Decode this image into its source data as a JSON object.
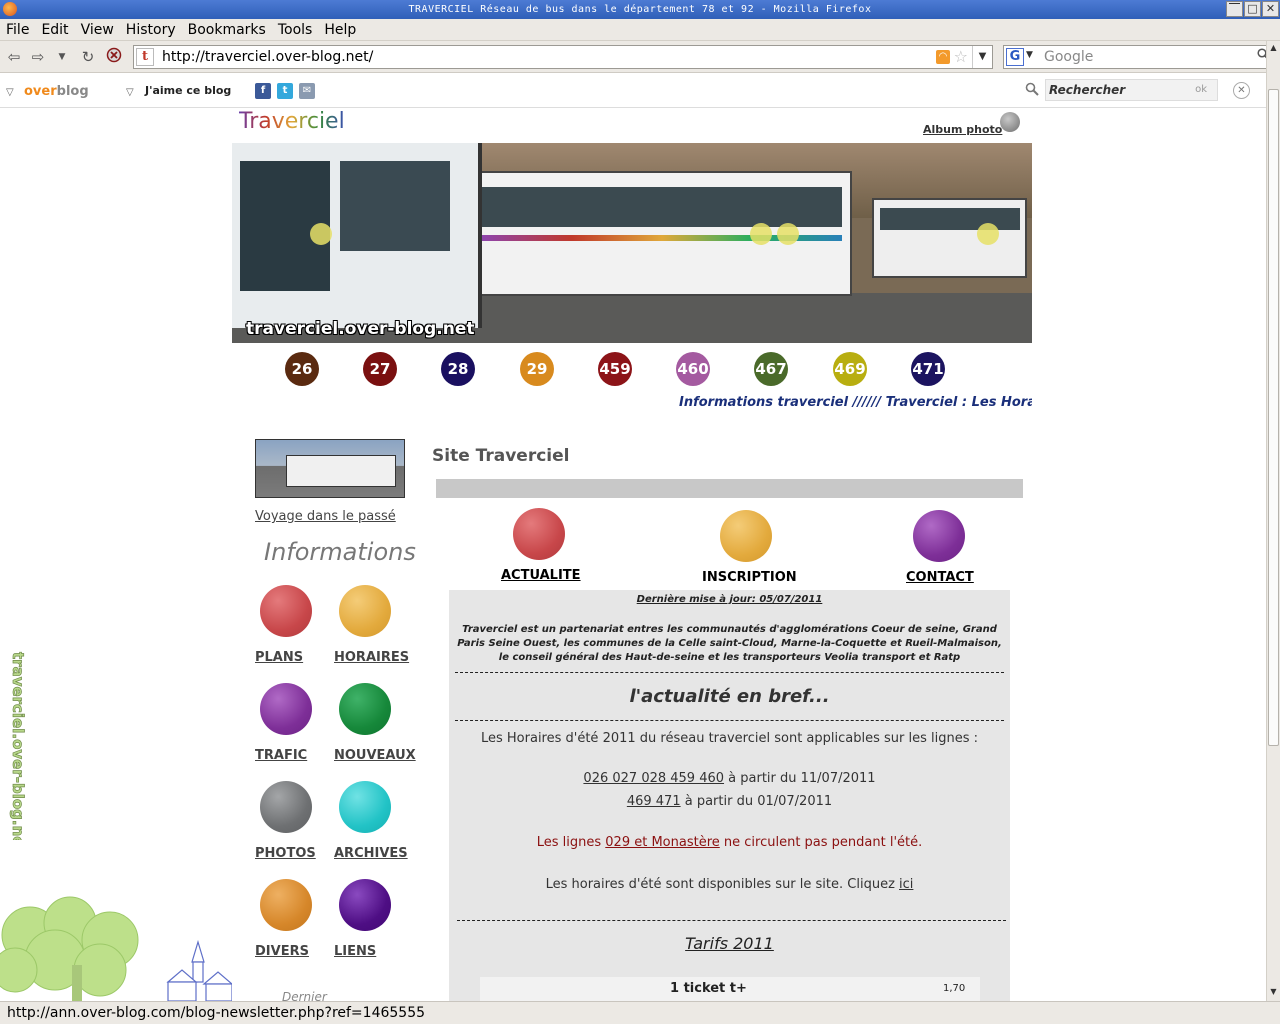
{
  "window": {
    "title": "TRAVERCIEL Réseau de bus dans le département 78 et 92 - Mozilla Firefox",
    "controls": [
      "⎺",
      "□",
      "✕"
    ]
  },
  "menu": [
    "File",
    "Edit",
    "View",
    "History",
    "Bookmarks",
    "Tools",
    "Help"
  ],
  "nav": {
    "url": "http://traverciel.over-blog.net/",
    "favicon_letter": "t",
    "search_engine_letter": "G",
    "search_placeholder": "Google"
  },
  "overblog_toolbar": {
    "logo_over": "over",
    "logo_blog": "blog",
    "like_label": "J'aime ce blog",
    "social": [
      "f",
      "t",
      "✉"
    ],
    "search_label": "Rechercher",
    "search_ok": "ok"
  },
  "status_bar": "http://ann.over-blog.com/blog-newsletter.php?ref=1465555",
  "page": {
    "blog_title": "Traverciel",
    "album_link": "Album photo",
    "banner_watermark": "traverciel.over-blog.net",
    "lines": [
      {
        "num": "26",
        "color": "#5a2a10"
      },
      {
        "num": "27",
        "color": "#7a1010"
      },
      {
        "num": "28",
        "color": "#1a1060"
      },
      {
        "num": "29",
        "color": "#d88a1e"
      },
      {
        "num": "459",
        "color": "#8c1418"
      },
      {
        "num": "460",
        "color": "#a45aa0"
      },
      {
        "num": "467",
        "color": "#4a6a2a"
      },
      {
        "num": "469",
        "color": "#b8ae10"
      },
      {
        "num": "471",
        "color": "#1c1460"
      }
    ],
    "marquee": "Informations traverciel //////  Traverciel : Les Horair",
    "sidebar": {
      "voyage_link": "Voyage dans le passé",
      "info_title": "Informations",
      "items": [
        {
          "label": "PLANS",
          "color": "#c8474a"
        },
        {
          "label": "HORAIRES",
          "color": "#e3aa3d"
        },
        {
          "label": "TRAFIC",
          "color": "#7e2f98"
        },
        {
          "label": "NOUVEAUX",
          "color": "#16883a"
        },
        {
          "label": "PHOTOS",
          "color": "#6e7072"
        },
        {
          "label": "ARCHIVES",
          "color": "#22c3c6"
        },
        {
          "label": "DIVERS",
          "color": "#d6872a"
        },
        {
          "label": "LIENS",
          "color": "#4e0e84"
        }
      ],
      "bottom_label": "Dernier"
    },
    "main": {
      "site_title": "Site Traverciel",
      "top_links": [
        {
          "label": "ACTUALITE",
          "color": "#c8474a",
          "underlined": true
        },
        {
          "label": "INSCRIPTION",
          "color": "#e3aa3d",
          "underlined": false
        },
        {
          "label": "CONTACT",
          "color": "#7e2f98",
          "underlined": true
        }
      ],
      "last_update": "Dernière mise à jour: 05/07/2011",
      "description": "Traverciel est un partenariat entres les communautés d'agglomérations Coeur de seine, Grand Paris Seine Ouest, les communes de la Celle saint-Cloud, Marne-la-Coquette et Rueil-Malmaison, le conseil général des Haut-de-seine et les transporteurs Veolia transport et Ratp",
      "news_title": "l'actualité en bref...",
      "news_intro": "Les Horaires d'été 2011 du réseau traverciel sont applicables sur les lignes :",
      "schedule1_lines": "026 027 028 459 460",
      "schedule1_date": " à partir du 11/07/2011",
      "schedule2_lines": "469 471",
      "schedule2_date": " à partir du 01/07/2011",
      "alert_prefix": "Les lignes ",
      "alert_link": "029 et Monastère",
      "alert_suffix": " ne circulent pas pendant l'été.",
      "site_note_prefix": "Les horaires d'été sont disponibles sur le site. Cliquez ",
      "site_note_link": "ici",
      "tarifs_title": "Tarifs 2011",
      "ticket_name": "1 ticket t+",
      "ticket_price": "1,70"
    },
    "vertical_watermark": "traverciel.over-blog.net"
  }
}
